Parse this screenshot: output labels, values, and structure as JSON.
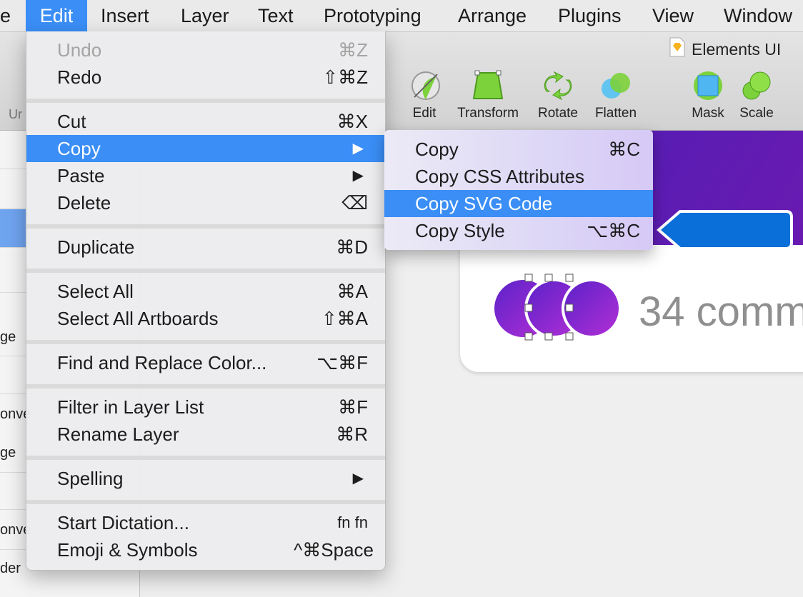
{
  "menubar": {
    "items": [
      "e",
      "Edit",
      "Insert",
      "Layer",
      "Text",
      "Prototyping",
      "Arrange",
      "Plugins",
      "View",
      "Window"
    ]
  },
  "document": {
    "title": "Elements UI"
  },
  "toolbar": {
    "left_fragment": "Ur",
    "tools": [
      "Edit",
      "Transform",
      "Rotate",
      "Flatten",
      "Mask",
      "Scale"
    ]
  },
  "left_panel": {
    "fragments": [
      "ge",
      "onve",
      "ge",
      "onve",
      "der"
    ]
  },
  "edit_menu": {
    "items": [
      {
        "label": "Undo",
        "shortcut": "⌘Z"
      },
      {
        "label": "Redo",
        "shortcut": "⇧⌘Z"
      },
      {
        "label": "Cut",
        "shortcut": "⌘X"
      },
      {
        "label": "Copy",
        "shortcut": "▶"
      },
      {
        "label": "Paste",
        "shortcut": "▶"
      },
      {
        "label": "Delete",
        "shortcut": "⌫"
      },
      {
        "label": "Duplicate",
        "shortcut": "⌘D"
      },
      {
        "label": "Select All",
        "shortcut": "⌘A"
      },
      {
        "label": "Select All Artboards",
        "shortcut": "⇧⌘A"
      },
      {
        "label": "Find and Replace Color...",
        "shortcut": "⌥⌘F"
      },
      {
        "label": "Filter in Layer List",
        "shortcut": "⌘F"
      },
      {
        "label": "Rename Layer",
        "shortcut": "⌘R"
      },
      {
        "label": "Spelling",
        "shortcut": "▶"
      },
      {
        "label": "Start Dictation...",
        "shortcut": "fn fn"
      },
      {
        "label": "Emoji & Symbols",
        "shortcut": "^⌘Space"
      }
    ]
  },
  "copy_submenu": {
    "items": [
      {
        "label": "Copy",
        "shortcut": "⌘C"
      },
      {
        "label": "Copy CSS Attributes",
        "shortcut": ""
      },
      {
        "label": "Copy SVG Code",
        "shortcut": ""
      },
      {
        "label": "Copy Style",
        "shortcut": "⌥⌘C"
      }
    ]
  },
  "canvas": {
    "comments_text": "34 comm"
  },
  "colors": {
    "accent": "#3a8ef6",
    "banner": "#5a1fb8",
    "avatar": "#8a2be2",
    "callout": "#0a6fd8"
  }
}
